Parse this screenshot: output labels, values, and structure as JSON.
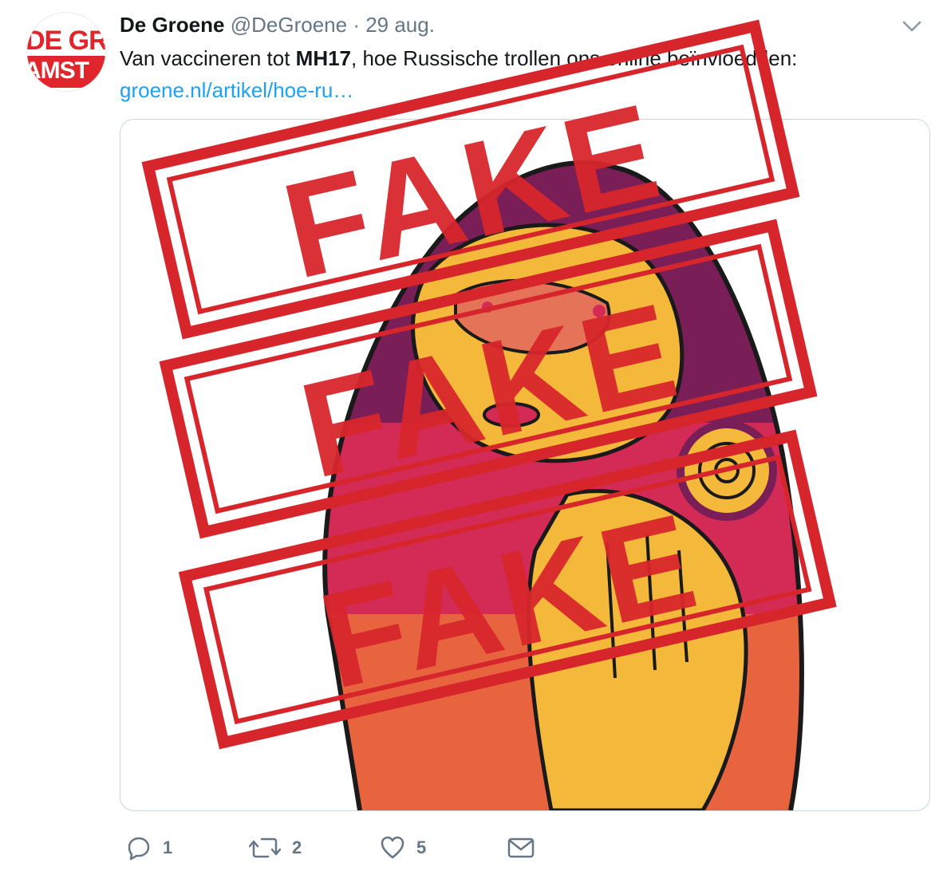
{
  "tweet": {
    "display_name": "De Groene",
    "handle": "@DeGroene",
    "separator": " · ",
    "date": "29 aug.",
    "text_before": "Van vaccineren tot ",
    "text_bold": "MH17",
    "text_after": ", hoe Russische trollen ons online beïnvloedden:",
    "link": "groene.nl/artikel/hoe-ru…"
  },
  "avatar": {
    "logo_text": "DE GROENE AMSTERDAMMER",
    "icon": "logo-avatar"
  },
  "stamps": {
    "word": "FAKE",
    "color": "#d7262b"
  },
  "actions": {
    "reply": {
      "icon": "reply-icon",
      "count": "1"
    },
    "retweet": {
      "icon": "retweet-icon",
      "count": "2"
    },
    "like": {
      "icon": "heart-icon",
      "count": "5"
    },
    "dm": {
      "icon": "envelope-icon"
    }
  },
  "colors": {
    "link": "#1da1f2",
    "muted": "#657786",
    "stamp": "#d7262b"
  }
}
